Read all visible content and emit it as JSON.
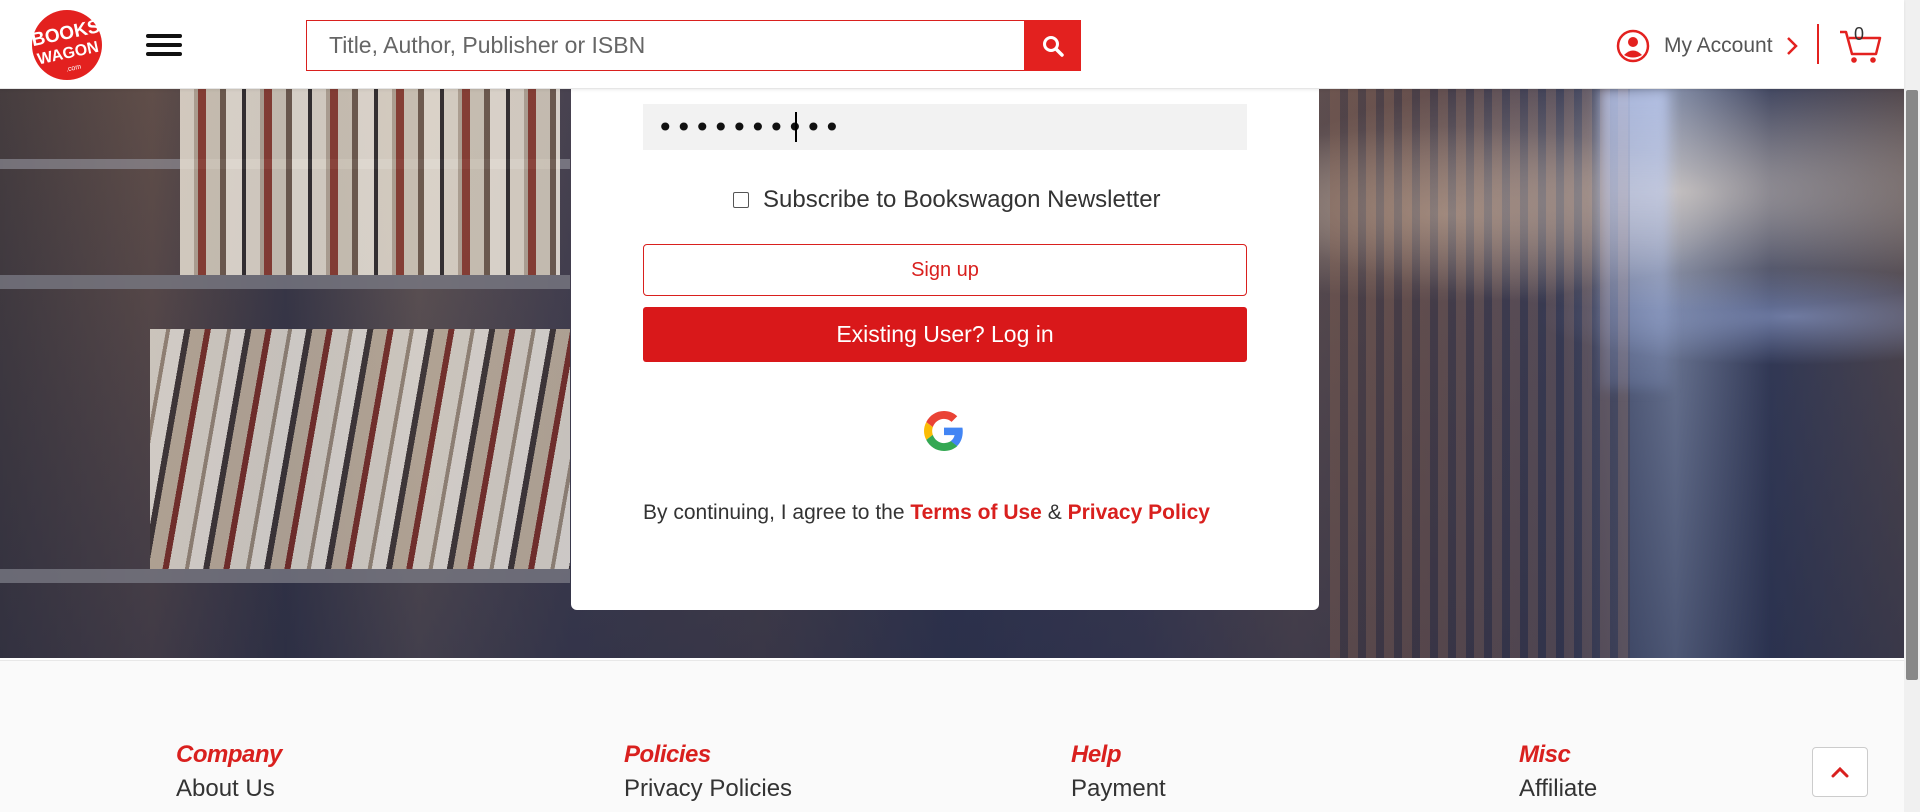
{
  "header": {
    "logo": {
      "line1": "BOOKS",
      "line2": "WAGON",
      "line3": ".com"
    },
    "search_placeholder": "Title, Author, Publisher or ISBN",
    "account_label": "My Account",
    "cart_count": "0",
    "icons": {
      "menu": "hamburger-icon",
      "search": "search-icon",
      "account": "user-circle-icon",
      "chevron": "chevron-right-icon",
      "cart": "cart-icon"
    }
  },
  "form": {
    "password_value": "••••••••••",
    "subscribe_label": "Subscribe to Bookswagon Newsletter",
    "subscribe_checked": false,
    "signup_label": "Sign up",
    "login_label": "Existing User? Log in",
    "terms_prefix": "By continuing, I agree to the",
    "terms_link": "Terms of Use",
    "terms_amp": "&",
    "privacy_link": "Privacy Policy"
  },
  "footer": {
    "columns": [
      {
        "heading": "Company",
        "first_link": "About Us"
      },
      {
        "heading": "Policies",
        "first_link": "Privacy Policies"
      },
      {
        "heading": "Help",
        "first_link": "Payment"
      },
      {
        "heading": "Misc",
        "first_link": "Affiliate"
      }
    ]
  },
  "colors": {
    "brand_red": "#d9201e",
    "button_red": "#d9181a"
  }
}
